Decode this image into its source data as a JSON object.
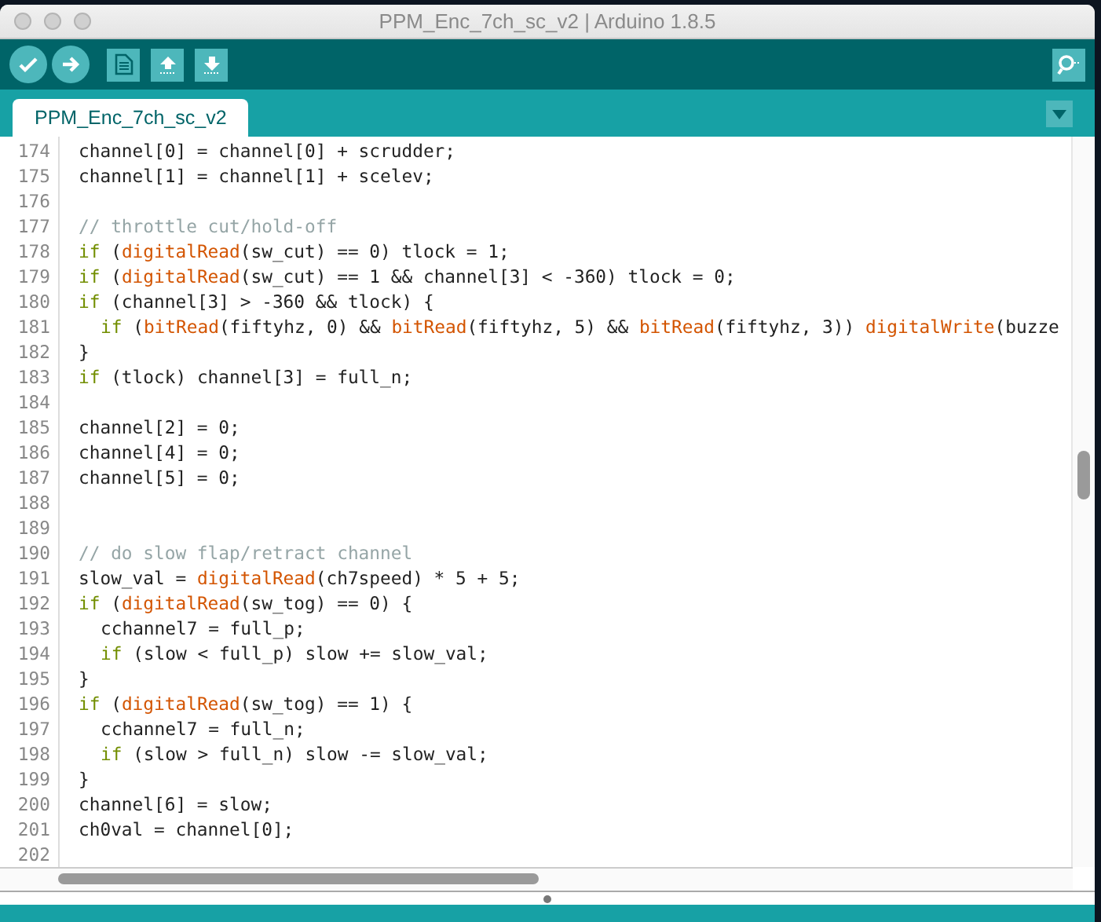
{
  "window": {
    "title": "PPM_Enc_7ch_sc_v2 | Arduino 1.8.5"
  },
  "tabs": [
    {
      "label": "PPM_Enc_7ch_sc_v2",
      "selected": true
    }
  ],
  "editor": {
    "lines": [
      {
        "number": "174",
        "tokens": [
          {
            "kind": "plain",
            "text": "channel[0] = channel[0] + scrudder;"
          }
        ]
      },
      {
        "number": "175",
        "tokens": [
          {
            "kind": "plain",
            "text": "channel[1] = channel[1] + scelev;"
          }
        ]
      },
      {
        "number": "176"
      },
      {
        "number": "177",
        "tokens": [
          {
            "kind": "comment",
            "text": "// throttle cut/hold-off"
          }
        ]
      },
      {
        "number": "178",
        "tokens": [
          {
            "kind": "keyword",
            "text": "if"
          },
          {
            "kind": "plain",
            "text": " ("
          },
          {
            "kind": "function",
            "text": "digitalRead"
          },
          {
            "kind": "plain",
            "text": "(sw_cut) == 0) tlock = 1;"
          }
        ]
      },
      {
        "number": "179",
        "tokens": [
          {
            "kind": "keyword",
            "text": "if"
          },
          {
            "kind": "plain",
            "text": " ("
          },
          {
            "kind": "function",
            "text": "digitalRead"
          },
          {
            "kind": "plain",
            "text": "(sw_cut) == 1 && channel[3] < -360) tlock = 0;"
          }
        ]
      },
      {
        "number": "180",
        "tokens": [
          {
            "kind": "keyword",
            "text": "if"
          },
          {
            "kind": "plain",
            "text": " (channel[3] > -360 && tlock) {"
          }
        ]
      },
      {
        "number": "181",
        "indented": true,
        "tokens": [
          {
            "kind": "keyword",
            "text": "if"
          },
          {
            "kind": "plain",
            "text": " ("
          },
          {
            "kind": "function",
            "text": "bitRead"
          },
          {
            "kind": "plain",
            "text": "(fiftyhz, 0) && "
          },
          {
            "kind": "function",
            "text": "bitRead"
          },
          {
            "kind": "plain",
            "text": "(fiftyhz, 5) && "
          },
          {
            "kind": "function",
            "text": "bitRead"
          },
          {
            "kind": "plain",
            "text": "(fiftyhz, 3)) "
          },
          {
            "kind": "function",
            "text": "digitalWrite"
          },
          {
            "kind": "plain",
            "text": "(buzze"
          }
        ]
      },
      {
        "number": "182",
        "tokens": [
          {
            "kind": "plain",
            "text": "}"
          }
        ]
      },
      {
        "number": "183",
        "tokens": [
          {
            "kind": "keyword",
            "text": "if"
          },
          {
            "kind": "plain",
            "text": " (tlock) channel[3] = full_n;"
          }
        ]
      },
      {
        "number": "184"
      },
      {
        "number": "185",
        "tokens": [
          {
            "kind": "plain",
            "text": "channel[2] = 0;"
          }
        ]
      },
      {
        "number": "186",
        "tokens": [
          {
            "kind": "plain",
            "text": "channel[4] = 0;"
          }
        ]
      },
      {
        "number": "187",
        "tokens": [
          {
            "kind": "plain",
            "text": "channel[5] = 0;"
          }
        ]
      },
      {
        "number": "188"
      },
      {
        "number": "189"
      },
      {
        "number": "190",
        "tokens": [
          {
            "kind": "comment",
            "text": "// do slow flap/retract channel"
          }
        ]
      },
      {
        "number": "191",
        "tokens": [
          {
            "kind": "plain",
            "text": "slow_val = "
          },
          {
            "kind": "function",
            "text": "digitalRead"
          },
          {
            "kind": "plain",
            "text": "(ch7speed) * 5 + 5;"
          }
        ]
      },
      {
        "number": "192",
        "tokens": [
          {
            "kind": "keyword",
            "text": "if"
          },
          {
            "kind": "plain",
            "text": " ("
          },
          {
            "kind": "function",
            "text": "digitalRead"
          },
          {
            "kind": "plain",
            "text": "(sw_tog) == 0) {"
          }
        ]
      },
      {
        "number": "193",
        "indented": true,
        "tokens": [
          {
            "kind": "plain",
            "text": "cchannel7 = full_p;"
          }
        ]
      },
      {
        "number": "194",
        "indented": true,
        "tokens": [
          {
            "kind": "keyword",
            "text": "if"
          },
          {
            "kind": "plain",
            "text": " (slow < full_p) slow += slow_val;"
          }
        ]
      },
      {
        "number": "195",
        "tokens": [
          {
            "kind": "plain",
            "text": "}"
          }
        ]
      },
      {
        "number": "196",
        "tokens": [
          {
            "kind": "keyword",
            "text": "if"
          },
          {
            "kind": "plain",
            "text": " ("
          },
          {
            "kind": "function",
            "text": "digitalRead"
          },
          {
            "kind": "plain",
            "text": "(sw_tog) == 1) {"
          }
        ]
      },
      {
        "number": "197",
        "indented": true,
        "tokens": [
          {
            "kind": "plain",
            "text": "cchannel7 = full_n;"
          }
        ]
      },
      {
        "number": "198",
        "indented": true,
        "tokens": [
          {
            "kind": "keyword",
            "text": "if"
          },
          {
            "kind": "plain",
            "text": " (slow > full_n) slow -= slow_val;"
          }
        ]
      },
      {
        "number": "199",
        "tokens": [
          {
            "kind": "plain",
            "text": "}"
          }
        ]
      },
      {
        "number": "200",
        "tokens": [
          {
            "kind": "plain",
            "text": "channel[6] = slow;"
          }
        ]
      },
      {
        "number": "201",
        "tokens": [
          {
            "kind": "plain",
            "text": "ch0val = channel[0];"
          }
        ]
      },
      {
        "number": "202"
      }
    ]
  }
}
